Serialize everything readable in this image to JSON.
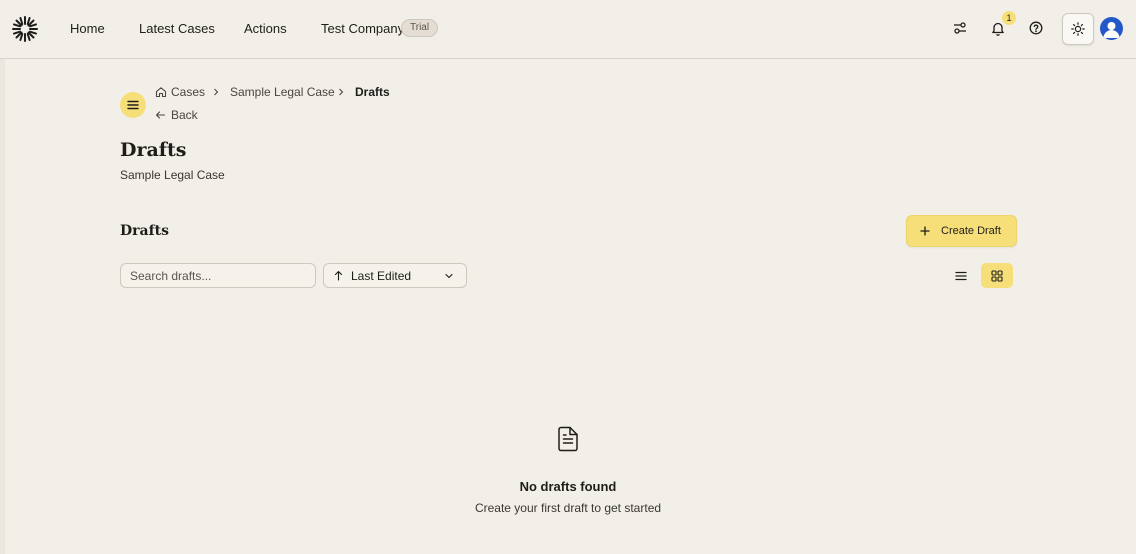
{
  "nav": {
    "home": "Home",
    "latest_cases": "Latest Cases",
    "actions": "Actions",
    "company": "Test Company",
    "trial": "Trial"
  },
  "header_icons": {
    "filters": "sliders-icon",
    "notifications": "bell-icon",
    "notification_count": "1",
    "help": "help-circle-icon",
    "theme": "sun-icon",
    "user": "user-avatar"
  },
  "breadcrumb": {
    "items": [
      "Cases",
      "Sample Legal Case",
      "Drafts"
    ],
    "back": "Back"
  },
  "page": {
    "title": "Drafts",
    "subtitle": "Sample Legal Case"
  },
  "drafts": {
    "section_title": "Drafts",
    "create_label": "Create Draft",
    "search_placeholder": "Search drafts...",
    "sort_label": "Last Edited",
    "view_mode": "grid"
  },
  "empty_state": {
    "title": "No drafts found",
    "subtitle": "Create your first draft to get started"
  },
  "colors": {
    "accent": "#f6df79",
    "background": "#f2efe9",
    "avatar": "#2358c9"
  }
}
